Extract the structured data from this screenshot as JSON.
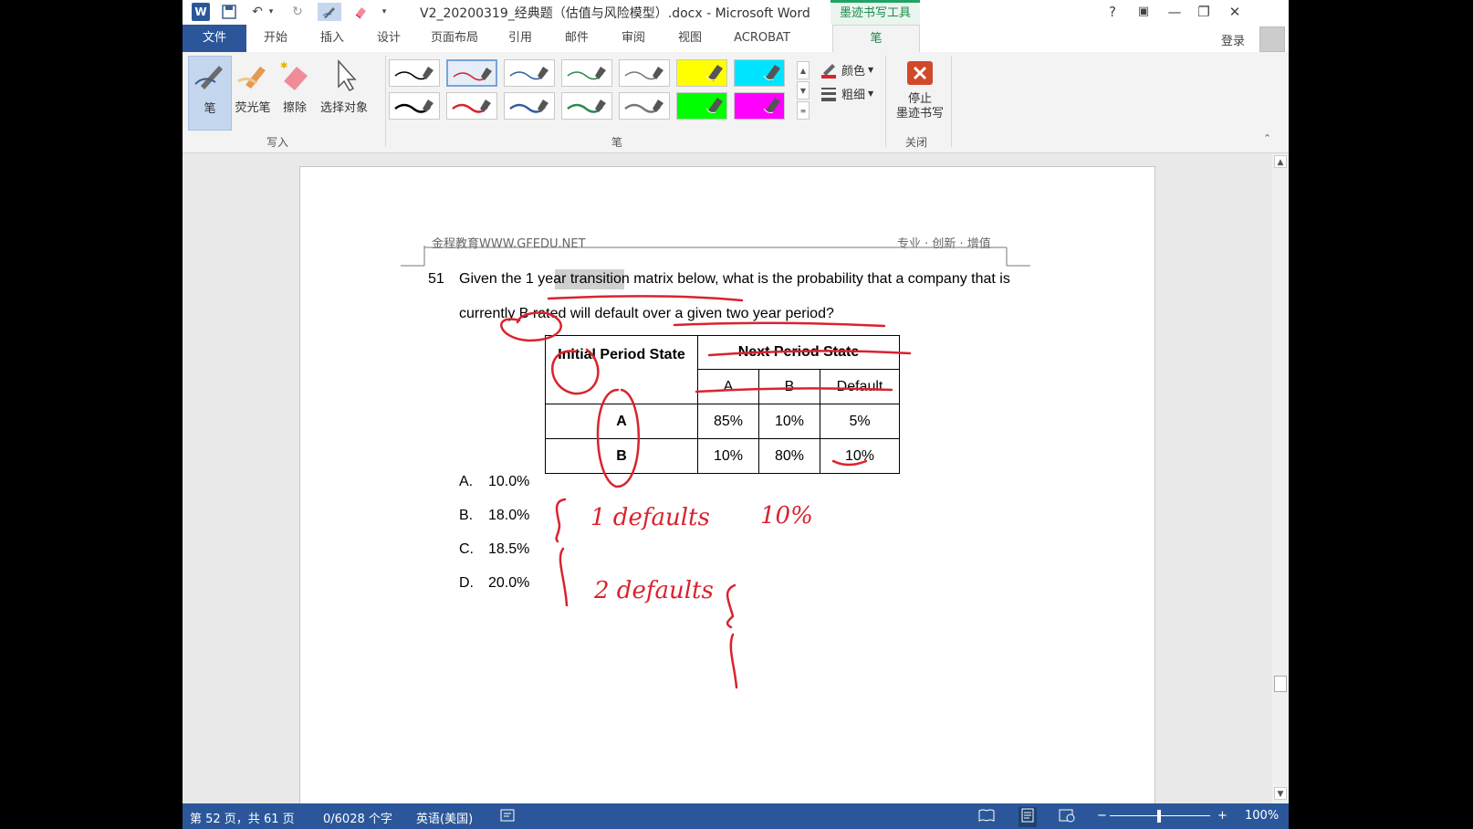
{
  "window": {
    "title": "V2_20200319_经典题（估值与风险模型）.docx - Microsoft Word",
    "context_tab_title": "墨迹书写工具",
    "help": "?",
    "restore_ribbon": "▣",
    "minimize": "—",
    "maximize": "❐",
    "close": "✕"
  },
  "tabs": {
    "file": "文件",
    "items": [
      "开始",
      "插入",
      "设计",
      "页面布局",
      "引用",
      "邮件",
      "审阅",
      "视图",
      "ACROBAT"
    ],
    "pen": "笔",
    "login": "登录"
  },
  "ribbon": {
    "write_group": {
      "label": "写入",
      "pen": "笔",
      "highlighter": "荧光笔",
      "eraser": "擦除",
      "select": "选择对象"
    },
    "pens_group": {
      "label": "笔",
      "swatches": [
        {
          "color": "#000000",
          "kind": "pen"
        },
        {
          "color": "#d9232e",
          "kind": "pen",
          "selected": true
        },
        {
          "color": "#2f5f9e",
          "kind": "pen"
        },
        {
          "color": "#2a8a4a",
          "kind": "pen"
        },
        {
          "color": "#777777",
          "kind": "pen"
        },
        {
          "color": "#ffff00",
          "kind": "highlighter"
        },
        {
          "color": "#00e5ff",
          "kind": "highlighter"
        },
        {
          "color": "#000000",
          "kind": "pen-thick"
        },
        {
          "color": "#d9232e",
          "kind": "pen-thick"
        },
        {
          "color": "#2f5f9e",
          "kind": "pen-thick"
        },
        {
          "color": "#2a8a4a",
          "kind": "pen-thick"
        },
        {
          "color": "#777777",
          "kind": "pen-thick"
        },
        {
          "color": "#00ff00",
          "kind": "highlighter"
        },
        {
          "color": "#ff00ff",
          "kind": "highlighter"
        }
      ],
      "color_label": "颜色",
      "thickness_label": "粗细"
    },
    "close_group": {
      "label": "关闭",
      "stop_line1": "停止",
      "stop_line2": "墨迹书写"
    }
  },
  "document": {
    "header_left": "金程教育WWW.GFEDU.NET",
    "header_right": "专业 · 创新 · 增值",
    "question_number": "51",
    "question_line1": "Given the 1 year transition matrix below, what is the probability that a company that is",
    "question_line2": "currently B rated will default over a given two year period?",
    "matrix": {
      "corner": "Initial Period State",
      "next_header": "Next Period State",
      "columns": [
        "A",
        "B",
        "Default"
      ],
      "rows": [
        {
          "state": "A",
          "values": [
            "85%",
            "10%",
            "5%"
          ]
        },
        {
          "state": "B",
          "values": [
            "10%",
            "80%",
            "10%"
          ]
        }
      ]
    },
    "options": [
      {
        "letter": "A.",
        "value": "10.0%"
      },
      {
        "letter": "B.",
        "value": "18.0%"
      },
      {
        "letter": "C.",
        "value": "18.5%"
      },
      {
        "letter": "D.",
        "value": "20.0%"
      }
    ],
    "ink_color": "#d9232e",
    "ink_text": {
      "note1": "1 defaults",
      "note2": "2 defaults",
      "note3": "10%"
    }
  },
  "statusbar": {
    "page": "第 52 页，共 61 页",
    "words": "0/6028 个字",
    "language": "英语(美国)",
    "zoom": "100%"
  }
}
